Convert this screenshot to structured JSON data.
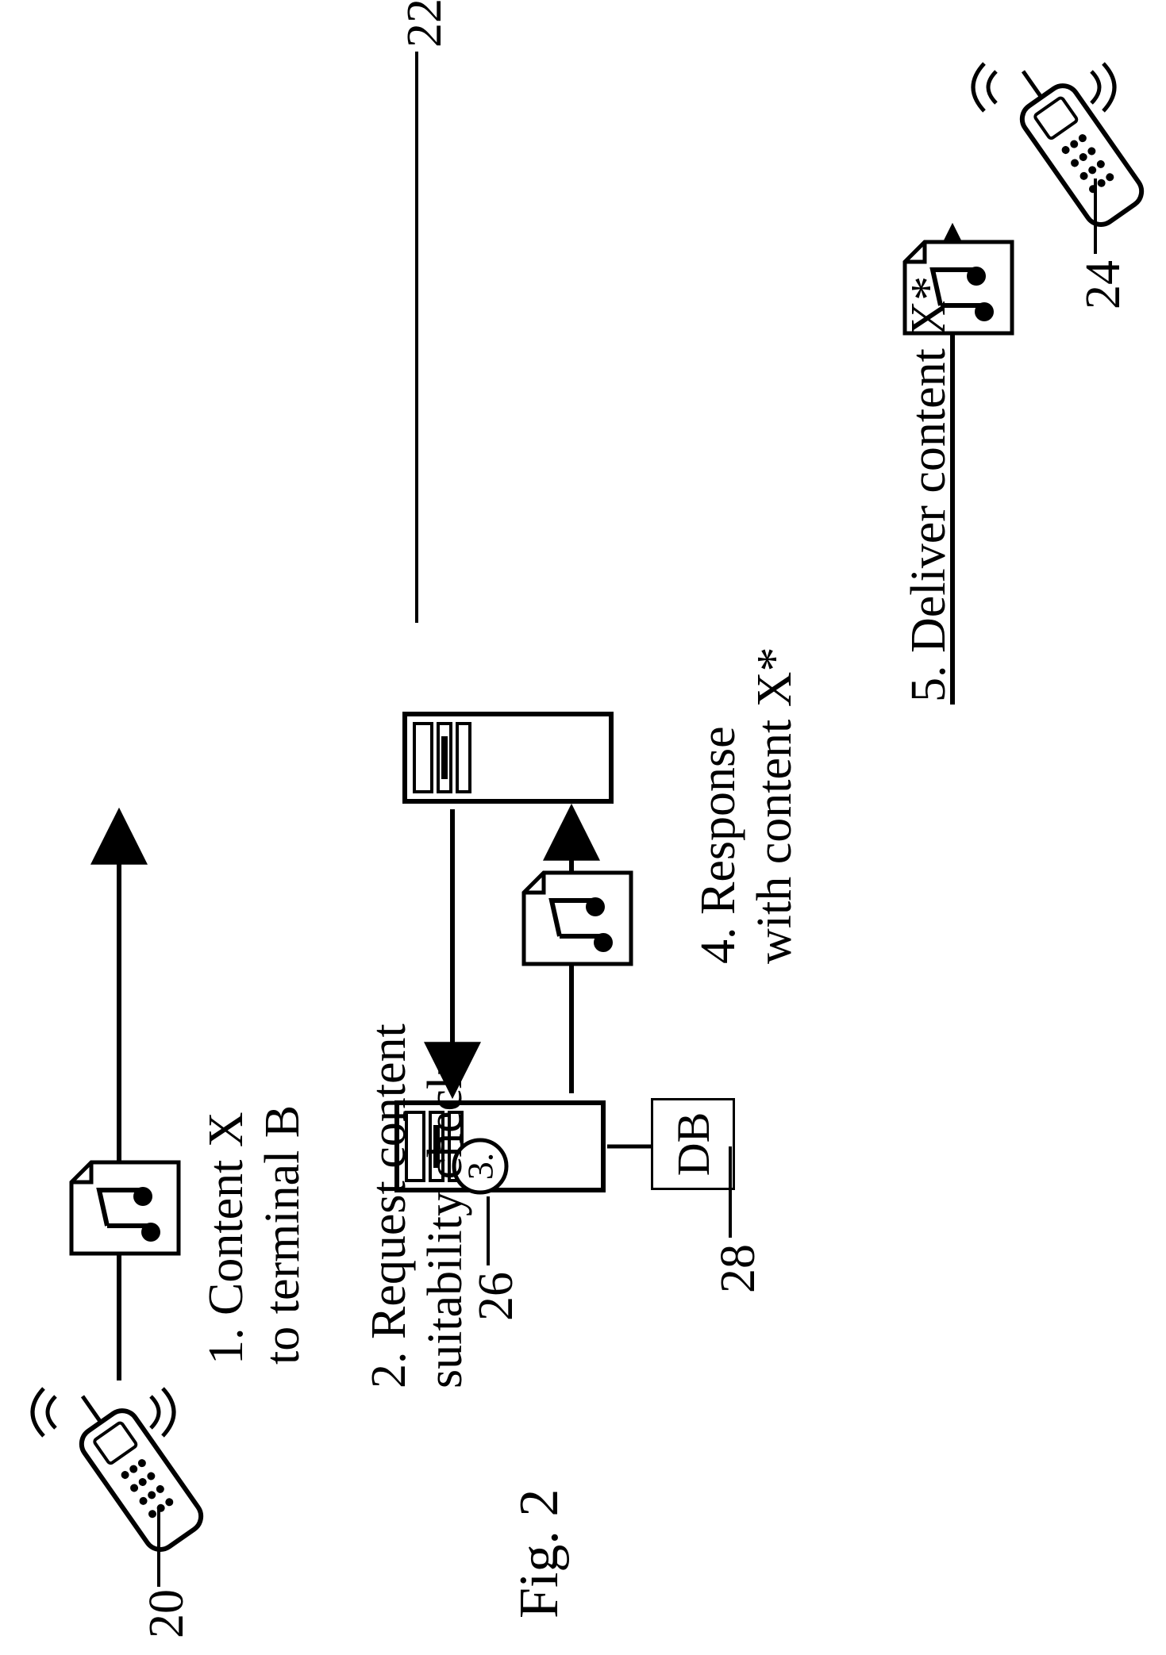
{
  "figure_label": "Fig. 2",
  "refs": {
    "r20": "20",
    "r22": "22",
    "r24": "24",
    "r26": "26",
    "r28": "28"
  },
  "steps": {
    "s1_line1": "1. Content X",
    "s1_line2": "to terminal B",
    "s2_line1": "2. Request content",
    "s2_line2": "suitability check",
    "s4_line1": "4. Response",
    "s4_line2": "with content X*",
    "s5_line1": "5. Deliver content X*"
  },
  "labels": {
    "step3_circle": "3.",
    "db": "DB"
  }
}
